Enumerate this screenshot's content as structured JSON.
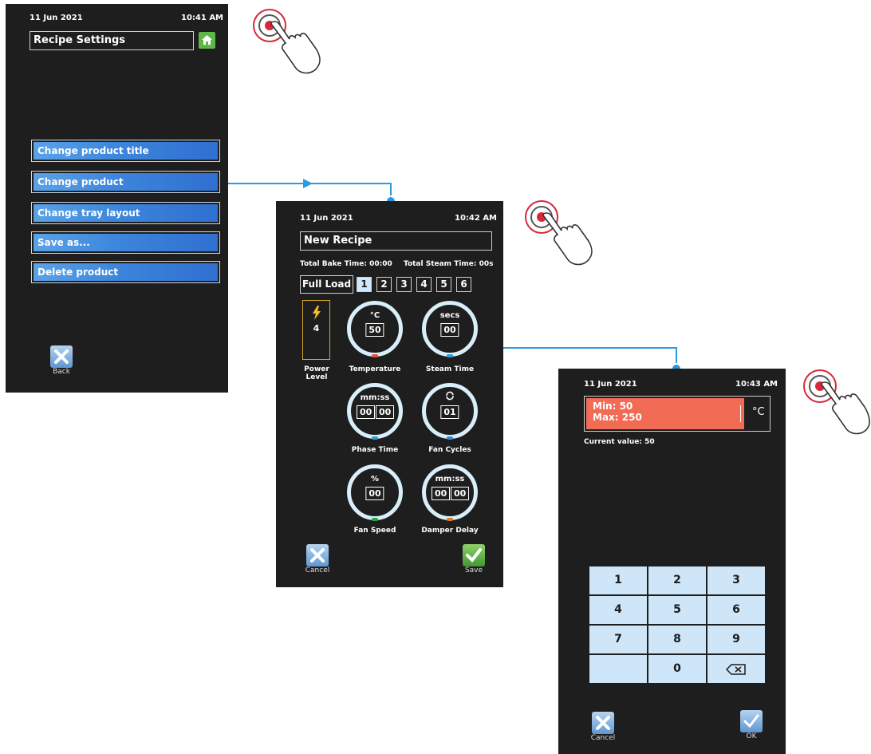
{
  "screen1": {
    "date": "11 Jun 2021",
    "time": "10:41 AM",
    "title": "Recipe Settings",
    "menu": [
      {
        "label": "Change product title"
      },
      {
        "label": "Change product"
      },
      {
        "label": "Change tray layout"
      },
      {
        "label": "Save as..."
      },
      {
        "label": "Delete product"
      }
    ],
    "back_label": "Back",
    "home_icon": "home-icon"
  },
  "screen2": {
    "date": "11 Jun 2021",
    "time": "10:42 AM",
    "title": "New Recipe",
    "total_bake": "Total Bake Time: 00:00",
    "total_steam": "Total Steam Time: 00s",
    "full_load": "Full Load",
    "tabs": [
      "1",
      "2",
      "3",
      "4",
      "5",
      "6"
    ],
    "active_tab": "1",
    "power_value": "4",
    "power_label": "Power Level",
    "dials": [
      {
        "unit": "°C",
        "value": "50",
        "label": "Temperature",
        "color": "#e8503a"
      },
      {
        "unit": "secs",
        "value": "00",
        "label": "Steam Time",
        "color": "#2a9fd8"
      },
      {
        "unit": "mm:ss",
        "value_a": "00",
        "value_b": "00",
        "label": "Phase Time",
        "color": "#2a9fd8"
      },
      {
        "unit": "refresh-icon",
        "value": "01",
        "label": "Fan Cycles",
        "color": "#3a8ad8"
      },
      {
        "unit": "%",
        "value": "00",
        "label": "Fan Speed",
        "color": "#2aa84a"
      },
      {
        "unit": "mm:ss",
        "value_a": "00",
        "value_b": "00",
        "label": "Damper Delay",
        "color": "#e07a2a"
      }
    ],
    "cancel_label": "Cancel",
    "save_label": "Save"
  },
  "screen3": {
    "date": "11 Jun 2021",
    "time": "10:43 AM",
    "min": "Min: 50",
    "max": "Max: 250",
    "unit": "°C",
    "current": "Current value: 50",
    "keys": [
      "1",
      "2",
      "3",
      "4",
      "5",
      "6",
      "7",
      "8",
      "9",
      "",
      "0",
      "backspace-icon"
    ],
    "cancel_label": "Cancel",
    "ok_label": "OK",
    "field_color": "#f26b55"
  }
}
